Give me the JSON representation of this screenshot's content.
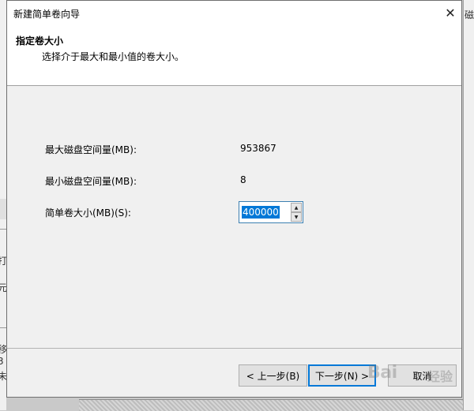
{
  "dialog": {
    "title": "新建简单卷向导",
    "close_glyph": "✕",
    "header_title": "指定卷大小",
    "header_subtitle": "选择介于最大和最小值的卷大小。"
  },
  "fields": {
    "max_label": "最大磁盘空间量(MB):",
    "max_value": "953867",
    "min_label": "最小磁盘空间量(MB):",
    "min_value": "8",
    "size_label": "简单卷大小(MB)(S):",
    "size_value": "400000"
  },
  "buttons": {
    "back": "< 上一步(B)",
    "next": "下一步(N) >",
    "cancel": "取消"
  },
  "watermark": {
    "logo": "Bai",
    "cn": "经验"
  },
  "background": {
    "right_char": "磁",
    "left_fragments": [
      "打",
      "元",
      "移",
      "3",
      "未"
    ]
  },
  "colors": {
    "accent": "#0078d7",
    "dialog_bg": "#f0f0f0"
  },
  "icons": {
    "close": "close-icon",
    "spin_up": "chevron-up-icon",
    "spin_down": "chevron-down-icon",
    "watermark": "paw-icon"
  }
}
